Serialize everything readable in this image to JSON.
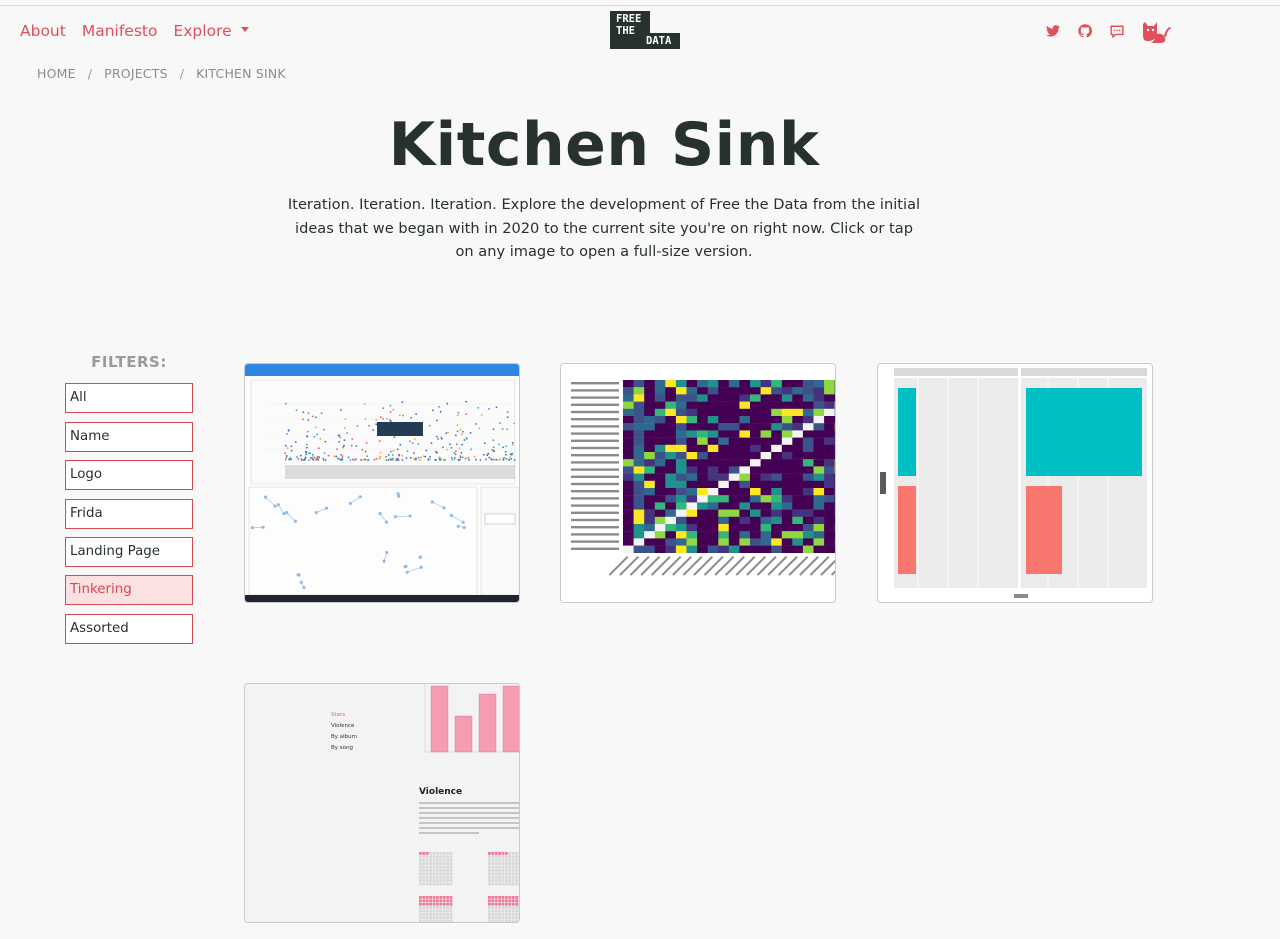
{
  "nav": {
    "links": [
      "About",
      "Manifesto",
      "Explore"
    ],
    "logo_lines": [
      "FREE",
      "THE",
      "DATA"
    ],
    "icons": [
      "twitter-icon",
      "github-icon",
      "comment-icon",
      "cat-icon"
    ]
  },
  "breadcrumb": [
    "HOME",
    "PROJECTS",
    "KITCHEN SINK"
  ],
  "page": {
    "title": "Kitchen Sink",
    "description": "Iteration. Iteration. Iteration. Explore the development of Free the Data from the initial ideas that we began with in 2020 to the current site you're on right now. Click or tap on any image to open a full-size version."
  },
  "filters": {
    "title": "FILTERS:",
    "items": [
      "All",
      "Name",
      "Logo",
      "Frida",
      "Landing Page",
      "Tinkering",
      "Assorted"
    ],
    "active": "Tinkering"
  },
  "gallery": {
    "thumbnail_4": {
      "menu": [
        "Stars",
        "Violence",
        "By album",
        "By song"
      ],
      "heading": "Violence"
    }
  },
  "colors": {
    "accent": "#e0505a",
    "text": "#27312e",
    "active_filter_bg": "#fbe1e2",
    "background": "#f7f8f7"
  }
}
